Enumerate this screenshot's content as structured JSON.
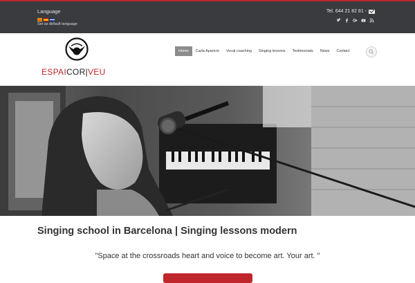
{
  "topbar": {
    "language_title": "Language",
    "set_default": "Set as default language",
    "phone": "Tel. 644 21 82 81 -",
    "flags": [
      "catalan-flag-icon",
      "spanish-flag-icon",
      "english-flag-icon"
    ],
    "socials": [
      "twitter-icon",
      "facebook-icon",
      "google-plus-icon",
      "youtube-icon",
      "rss-icon"
    ]
  },
  "logo": {
    "part1": "ESPAI",
    "part2": "COR",
    "part3": "VEU"
  },
  "nav": {
    "items": [
      "Home",
      "Carla Aparicio",
      "Vocal coaching",
      "Singing lessons",
      "Testimonials",
      "News",
      "Contact"
    ],
    "active": "Home"
  },
  "main": {
    "title": "Singing school in Barcelona | Singing lessons modern",
    "quote": "\"Space at the crossroads heart and voice to become art. Your art. \""
  },
  "colors": {
    "accent": "#c0272d",
    "topbar_bg": "#3a3b3f",
    "nav_active_bg": "#8c8c8c"
  }
}
